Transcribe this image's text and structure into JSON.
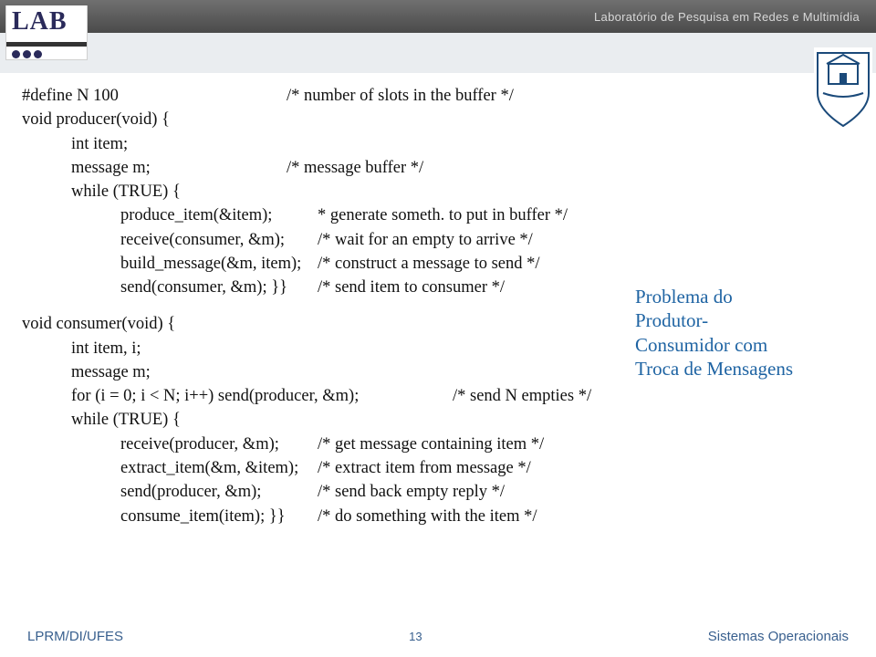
{
  "banner": {
    "lab": "Laboratório de Pesquisa em Redes e Multimídia"
  },
  "logo": {
    "text": "LAB"
  },
  "code": {
    "l1a": "#define N 100",
    "l1b": "/* number of slots in the buffer */",
    "l2": "void producer(void) {",
    "l3": "int item;",
    "l4a": "message m;",
    "l4b": "/* message buffer */",
    "l5": "while (TRUE) {",
    "l6a": "produce_item(&item);",
    "l6b": "* generate someth. to put in buffer */",
    "l7a": "receive(consumer, &m);",
    "l7b": "/* wait for an empty to arrive */",
    "l8a": "build_message(&m, item);",
    "l8b": "/* construct a message to send */",
    "l9a": "send(consumer, &m); }}",
    "l9b": "/* send item to consumer */",
    "l11": "void consumer(void) {",
    "l12": "int item, i;",
    "l13": "message m;",
    "l14a": "for (i = 0; i < N; i++) send(producer, &m);",
    "l14b": "/* send N empties */",
    "l15": "while (TRUE) {",
    "l16a": "receive(producer, &m);",
    "l16b": "/* get message containing item */",
    "l17a": "extract_item(&m, &item);",
    "l17b": "/* extract item from message */",
    "l18a": "send(producer, &m);",
    "l18b": "/* send back empty reply */",
    "l19a": "consume_item(item); }}",
    "l19b": "/* do something with the item */"
  },
  "callout": {
    "line1": "Problema do",
    "line2": "Produtor-",
    "line3": "Consumidor com",
    "line4": "Troca de Mensagens"
  },
  "footer": {
    "left": "LPRM/DI/UFES",
    "page": "13",
    "right": "Sistemas Operacionais"
  }
}
